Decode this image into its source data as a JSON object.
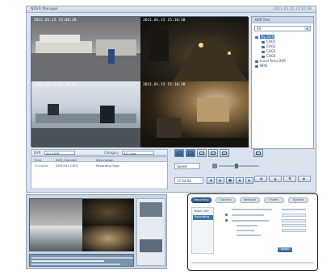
{
  "main_window": {
    "title": "NDVR Manager",
    "clock": "2011.01.15 15:10:38"
  },
  "video_tiles": [
    {
      "timestamp": "2011.01.15 15:06:28"
    },
    {
      "timestamp": "2011.01.15 15:10:38"
    },
    {
      "timestamp": "2011.01.15 15:10:38"
    },
    {
      "timestamp": "2011.01.15 15:10:38"
    }
  ],
  "side_panel": {
    "header": "DVR Tree",
    "selector_value": "All",
    "tree": [
      {
        "label": "My DVR",
        "selected": true
      },
      {
        "label": "CH01"
      },
      {
        "label": "CH02"
      },
      {
        "label": "CH03"
      },
      {
        "label": "CH04"
      },
      {
        "label": "Local Area DVR"
      },
      {
        "label": "NPD"
      }
    ],
    "ptz_buttons": [
      "◀",
      "▲",
      "▼",
      "▶"
    ]
  },
  "filter": {
    "dvr_label": "DVR",
    "dvr_value": "ALL DVR",
    "category_label": "Category",
    "category_value": "ALL Log"
  },
  "log_table": {
    "columns": [
      "Time",
      "DVR_Channel",
      "Description"
    ],
    "rows": [
      [
        "17:24:00",
        "DVR-001-CH01",
        "Recording Stop"
      ]
    ]
  },
  "playback": {
    "speed_value": "Speed",
    "time_value": "17:24:00",
    "controls": [
      "◀",
      "▶",
      "■",
      "◆",
      "▶"
    ]
  },
  "settings": {
    "tabs": [
      "Recording",
      "Camera",
      "Network",
      "Event",
      "System"
    ],
    "nav_items": [
      "Basic Info",
      "Recording"
    ],
    "apply_label": "Apply"
  },
  "colors": {
    "accent": "#2f5f93",
    "window_bg": "#dbe4ee"
  }
}
